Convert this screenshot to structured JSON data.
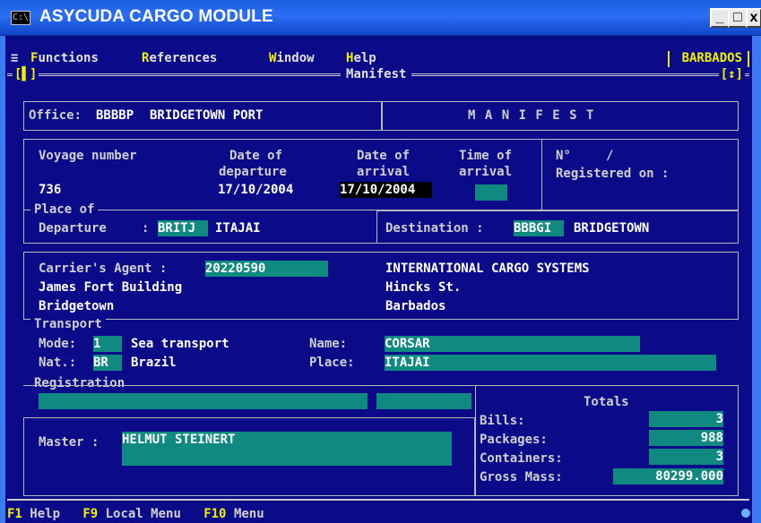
{
  "window": {
    "title": "ASYCUDA CARGO MODULE",
    "icon_text": "C:\\",
    "minimize": "_",
    "maximize": "□",
    "close": "x"
  },
  "menubar": {
    "system": "≡",
    "items": [
      {
        "hot": "F",
        "rest": "unctions"
      },
      {
        "hot": "R",
        "rest": "eferences"
      },
      {
        "hot": "W",
        "rest": "indow"
      },
      {
        "hot": "H",
        "rest": "elp"
      }
    ],
    "country": "BARBADOS"
  },
  "frame": {
    "title": "Manifest",
    "left_marker": "[▌]",
    "right_marker": "[↕]"
  },
  "office": {
    "label": "Office:",
    "code": "BBBBP",
    "name": "BRIDGETOWN PORT"
  },
  "header_title": "M A N I F E S T",
  "voyage": {
    "voyage_label": "Voyage number",
    "voyage_value": "736",
    "dep_label_1": "Date of",
    "dep_label_2": "departure",
    "dep_value": "17/10/2004",
    "arr_label_1": "Date of",
    "arr_label_2": "arrival",
    "arr_value": "17/10/2004",
    "time_label_1": "Time of",
    "time_label_2": "arrival",
    "time_value": "",
    "no_label": "N°",
    "no_sep": "/",
    "registered_label": "Registered on :"
  },
  "place": {
    "section": "Place of",
    "departure_label": "Departure",
    "colon": ":",
    "departure_code": "BRITJ",
    "departure_name": "ITAJAI",
    "destination_label": "Destination :",
    "destination_code": "BBBGI",
    "destination_name": "BRIDGETOWN"
  },
  "agent": {
    "label": "Carrier's Agent :",
    "code": "20220590",
    "address_1": "James Fort Building",
    "address_2": "Bridgetown",
    "company": "INTERNATIONAL CARGO SYSTEMS",
    "company_1": "Hincks St.",
    "company_2": "Barbados"
  },
  "transport": {
    "section": "Transport",
    "mode_label": "Mode:",
    "mode_code": "1",
    "mode_name": "Sea transport",
    "nat_label": "Nat.:",
    "nat_code": "BR",
    "nat_name": "Brazil",
    "name_label": "Name:",
    "name_value": "CORSAR",
    "place_label": "Place:",
    "place_value": "ITAJAI"
  },
  "registration": {
    "section": "Registration",
    "value_1": "",
    "value_2": ""
  },
  "master": {
    "label": "Master :",
    "value": "HELMUT STEINERT"
  },
  "totals": {
    "title": "Totals",
    "bills_label": "Bills:",
    "bills": "3",
    "packages_label": "Packages:",
    "packages": "988",
    "containers_label": "Containers:",
    "containers": "3",
    "gross_label": "Gross Mass:",
    "gross": "80299.000"
  },
  "fkeys": [
    {
      "key": "F1",
      "label": "Help"
    },
    {
      "key": "F9",
      "label": "Local Menu"
    },
    {
      "key": "F10",
      "label": "Menu"
    }
  ],
  "colors": {
    "background": "#0b0b8a",
    "field": "#108a80",
    "hotkey": "#f0f000",
    "titlebar": "#2a6ef5"
  }
}
